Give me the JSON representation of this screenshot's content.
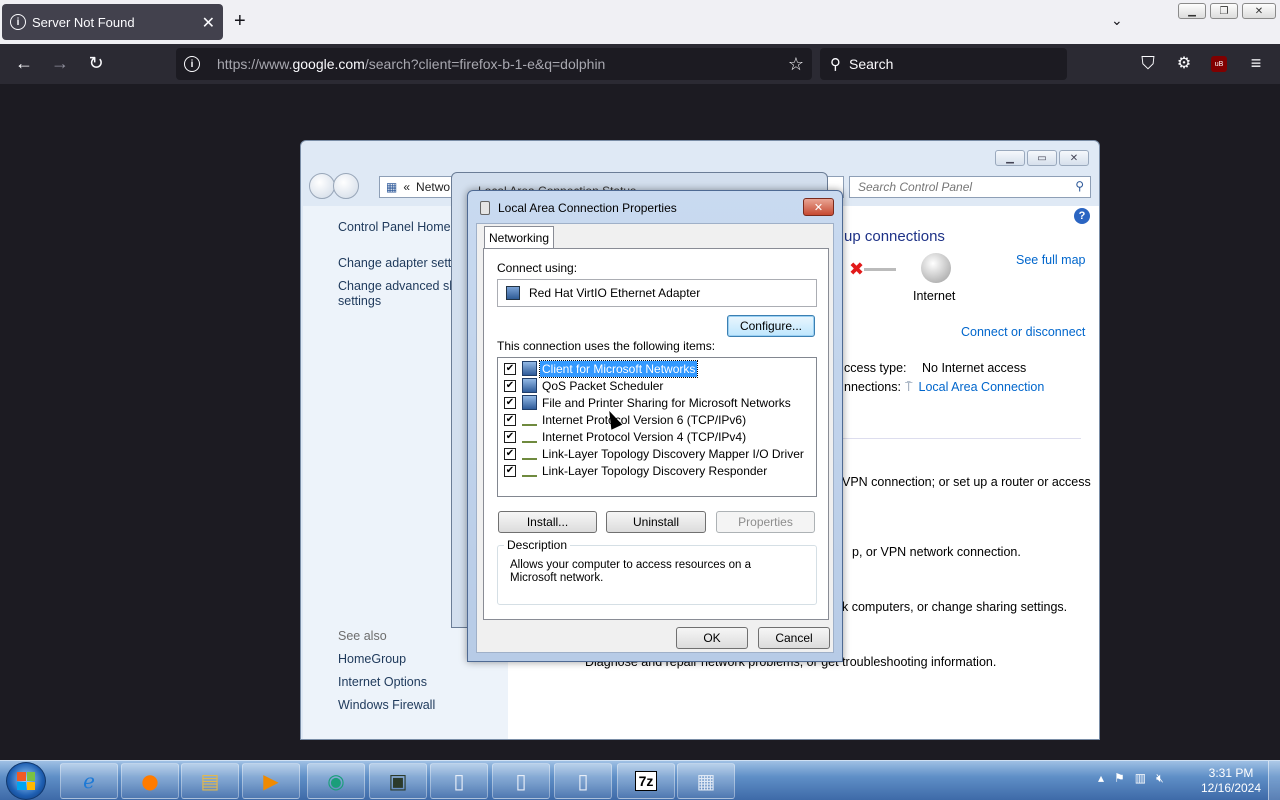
{
  "browser": {
    "tab_title": "Server Not Found",
    "url_prefix": "https://www.",
    "url_host": "google.com",
    "url_rest": "/search?client=firefox-b-1-e&q=dolphin",
    "search_placeholder": "Search",
    "new_tab_glyph": "+",
    "list_tabs_glyph": "⌄",
    "back_glyph": "←",
    "forward_glyph": "→",
    "reload_glyph": "↻",
    "star_glyph": "☆",
    "pocket_glyph": "⛉",
    "extensions_glyph": "⚙",
    "menu_glyph": "≡",
    "ublock_label": "uB",
    "close_glyph": "✕"
  },
  "control_panel": {
    "address": "Netwo",
    "search_placeholder": "Search Control Panel",
    "left_links": [
      "Control Panel Home",
      "Change adapter settin",
      "Change advanced sha",
      "settings"
    ],
    "see_also_header": "See also",
    "see_also": [
      "HomeGroup",
      "Internet Options",
      "Windows Firewall"
    ],
    "main_title": "up connections",
    "see_full_map": "See full map",
    "internet_label": "Internet",
    "connect_disconnect": "Connect or disconnect",
    "access_type_label": "ccess type:",
    "access_type_value": "No Internet access",
    "connections_label": "nnections:",
    "connections_value": "Local Area Connection",
    "task1": "VPN connection; or set up a router or access",
    "task2": "p, or VPN network connection.",
    "task3": "k computers, or change sharing settings.",
    "task4": "Diagnose and repair network problems, or get troubleshooting information."
  },
  "bg_dialog": {
    "title": "Local Area Connection Status"
  },
  "dialog": {
    "title": "Local Area Connection Properties",
    "tab": "Networking",
    "connect_using_label": "Connect using:",
    "adapter": "Red Hat VirtIO Ethernet Adapter",
    "configure_button": "Configure...",
    "items_label": "This connection uses the following items:",
    "items": [
      {
        "label": "Client for Microsoft Networks",
        "checked": true,
        "selected": true,
        "icon": "network-client-icon"
      },
      {
        "label": "QoS Packet Scheduler",
        "checked": true,
        "selected": false,
        "icon": "network-service-icon"
      },
      {
        "label": "File and Printer Sharing for Microsoft Networks",
        "checked": true,
        "selected": false,
        "icon": "network-service-icon"
      },
      {
        "label": "Internet Protocol Version 6 (TCP/IPv6)",
        "checked": true,
        "selected": false,
        "icon": "protocol-icon"
      },
      {
        "label": "Internet Protocol Version 4 (TCP/IPv4)",
        "checked": true,
        "selected": false,
        "icon": "protocol-icon"
      },
      {
        "label": "Link-Layer Topology Discovery Mapper I/O Driver",
        "checked": true,
        "selected": false,
        "icon": "protocol-icon"
      },
      {
        "label": "Link-Layer Topology Discovery Responder",
        "checked": true,
        "selected": false,
        "icon": "protocol-icon"
      }
    ],
    "install_button": "Install...",
    "uninstall_button": "Uninstall",
    "properties_button": "Properties",
    "description_label": "Description",
    "description_text": "Allows your computer to access resources on a Microsoft network.",
    "ok_button": "OK",
    "cancel_button": "Cancel"
  },
  "taskbar": {
    "time": "3:31 PM",
    "date": "12/16/2024",
    "sevenzip_label": "7z"
  }
}
